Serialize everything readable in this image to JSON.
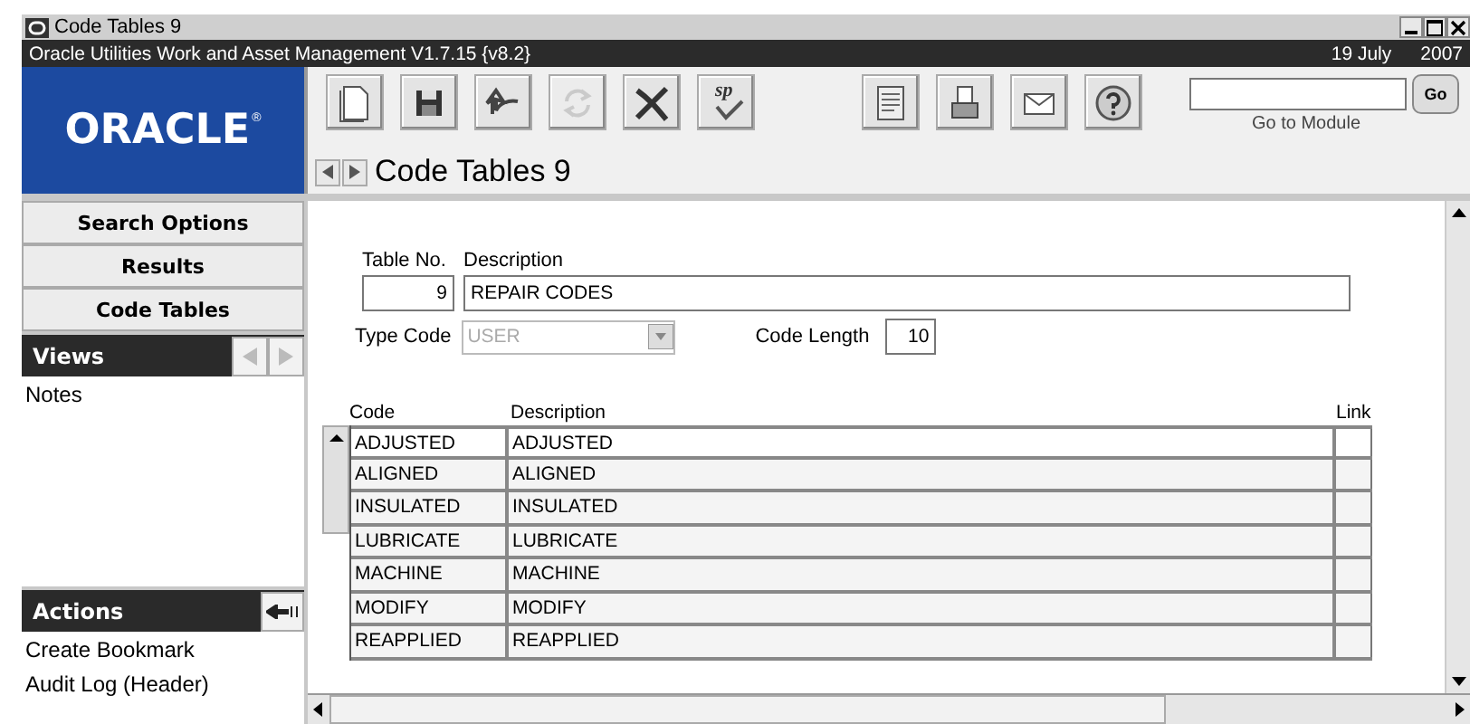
{
  "window": {
    "title": "Code Tables 9",
    "subtitle": "Oracle Utilities Work and Asset Management V1.7.15 {v8.2}",
    "date": "19 July",
    "year": "2007"
  },
  "logo": {
    "text": "ORACLE",
    "mark": "®"
  },
  "toolbar": [
    [
      {
        "kind": "new",
        "disabled": false
      },
      {
        "kind": "save",
        "disabled": false
      },
      {
        "kind": "undo",
        "disabled": false
      },
      {
        "kind": "refresh",
        "disabled": true
      },
      {
        "kind": "delete",
        "disabled": false
      },
      {
        "kind": "spell",
        "label": "sp",
        "disabled": false
      }
    ],
    [
      {
        "kind": "report",
        "disabled": false
      },
      {
        "kind": "print",
        "disabled": false
      },
      {
        "kind": "mail",
        "disabled": false
      },
      {
        "kind": "help",
        "disabled": false
      }
    ]
  ],
  "go_to_module": {
    "label": "Go to Module",
    "button": "Go"
  },
  "page_title": "Code Tables 9",
  "sidebar": {
    "nav": [
      "Search Options",
      "Results",
      "Code Tables"
    ],
    "views": {
      "title": "Views",
      "items": [
        "Notes"
      ]
    },
    "actions": {
      "title": "Actions",
      "items": [
        "Create Bookmark",
        "Audit Log (Header)"
      ]
    }
  },
  "form": {
    "table_no": {
      "label": "Table No.",
      "value": "9"
    },
    "description": {
      "label": "Description",
      "value": "REPAIR CODES"
    },
    "type_code": {
      "label": "Type Code",
      "value": "USER",
      "disabled": true
    },
    "code_length": {
      "label": "Code Length",
      "value": "10"
    }
  },
  "table": {
    "columns": [
      "Code",
      "Description",
      "Link"
    ],
    "rows": [
      {
        "code": "ADJUSTED",
        "description": "ADJUSTED"
      },
      {
        "code": "ALIGNED",
        "description": "ALIGNED"
      },
      {
        "code": "INSULATED",
        "description": "INSULATED"
      },
      {
        "code": "LUBRICATE",
        "description": "LUBRICATE"
      },
      {
        "code": "MACHINE",
        "description": "MACHINE"
      },
      {
        "code": "MODIFY",
        "description": "MODIFY"
      },
      {
        "code": "REAPPLIED",
        "description": "REAPPLIED"
      }
    ]
  }
}
